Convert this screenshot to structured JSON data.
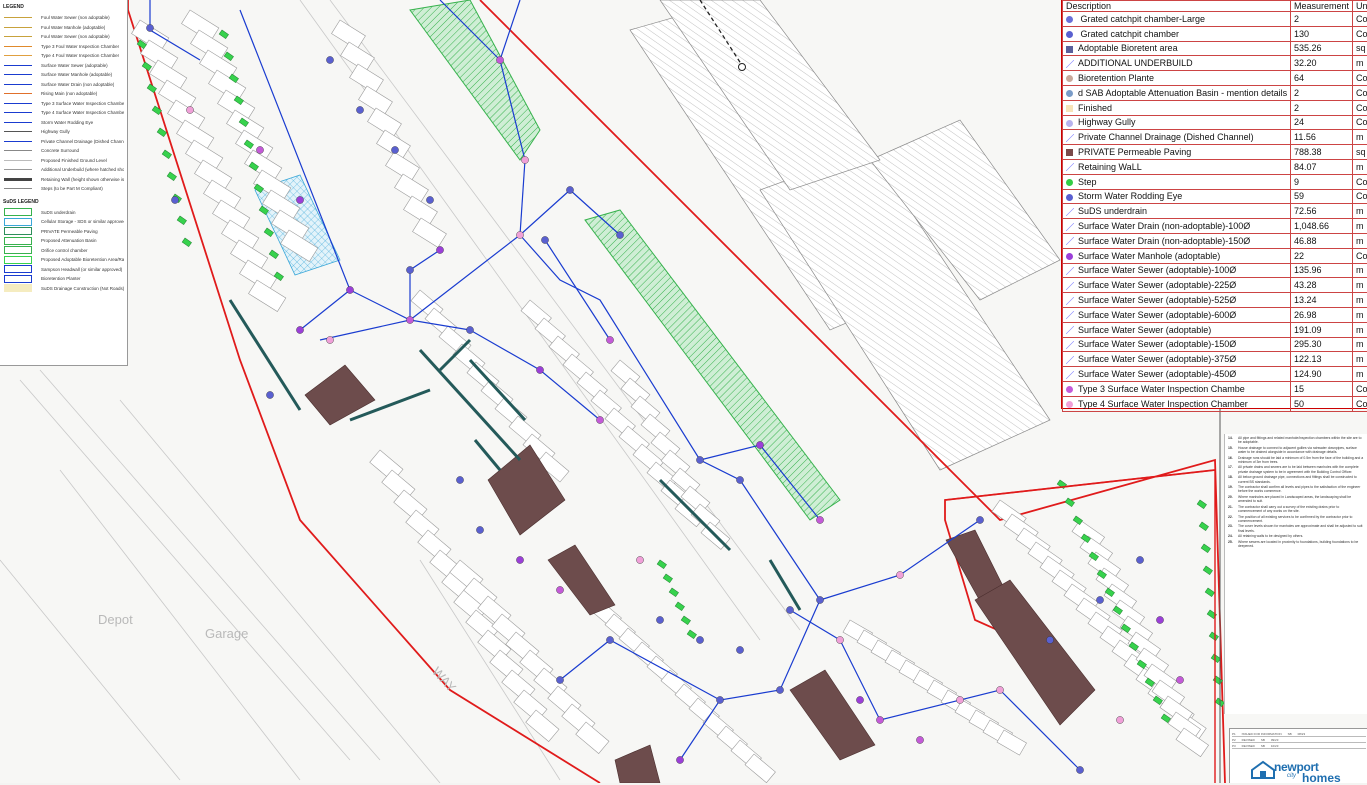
{
  "legend": {
    "title": "LEGEND",
    "items": [
      "Foul Water Sewer (non adoptable)",
      "Foul Water Manhole (adoptable)",
      "Foul Water Sewer (non adoptable)",
      "Type 3 Foul Water Inspection Chamber",
      "Type 4 Foul Water Inspection Chamber",
      "Surface Water Sewer (adoptable)",
      "Surface Water Manhole (adoptable)",
      "Surface Water Drain (non adoptable)",
      "Rising Main (non adoptable)",
      "Type 3 Surface Water Inspection Chamber",
      "Type 4 Surface Water Inspection Chamber",
      "Storm Water Rodding Eye",
      "Highway Gully",
      "Private Channel Drainage (Dished Channel)",
      "Concrete Surround",
      "Proposed Finished Ground Level",
      "Additional Underbuild (where hatched shown)",
      "Retaining Wall (height shown otherwise is levels - hatched line is retained side)",
      "Steps (to be Part M Compliant)"
    ],
    "suds_title": "SuDS LEGEND",
    "suds_items": [
      "SuDS underdrain",
      "Cellular Storage - SDS or similar approved",
      "PRIVATE Permeable Paving",
      "Proposed Attenuation Basin",
      "Orifice control chamber",
      "Proposed Adoptable Bioretention Area/Rain garden",
      "Sampson Headwall (or similar approved)",
      "Bioretention Planter",
      "SuDS Drainage Construction (Not Roads)"
    ]
  },
  "schedule": {
    "headers": [
      "Description",
      "Measurement",
      "Unit"
    ],
    "rows": [
      {
        "icon": "dot",
        "color": "#6a6fd8",
        "desc": " Grated catchpit chamber-Large",
        "value": "2",
        "unit": "Count"
      },
      {
        "icon": "dot",
        "color": "#5a60d0",
        "desc": " Grated catchpit chamber",
        "value": "130",
        "unit": "Count"
      },
      {
        "icon": "square",
        "color": "#5a5f9a",
        "desc": "Adoptable Bioretent area",
        "value": "535.26",
        "unit": "sq m"
      },
      {
        "icon": "slash",
        "color": "#8a8aff",
        "desc": "ADDITIONAL UNDERBUILD",
        "value": "32.20",
        "unit": "m"
      },
      {
        "icon": "dot",
        "color": "#c9a89a",
        "desc": "Bioretention Plante",
        "value": "64",
        "unit": "Count"
      },
      {
        "icon": "dot",
        "color": "#7a9cc8",
        "desc": "d SAB Adoptable Attenuation Basin - mention details",
        "value": "2",
        "unit": "Count"
      },
      {
        "icon": "square",
        "color": "#f7e3b8",
        "desc": "Finished",
        "value": "2",
        "unit": "Count"
      },
      {
        "icon": "dot",
        "color": "#b7b3ee",
        "desc": "Highway Gully",
        "value": "24",
        "unit": "Count"
      },
      {
        "icon": "slash",
        "color": "#8a8aff",
        "desc": "Private Channel Drainage (Dished Channel)",
        "value": "11.56",
        "unit": "m"
      },
      {
        "icon": "square",
        "color": "#7a4a4a",
        "desc": "PRIVATE Permeable Paving",
        "value": "788.38",
        "unit": "sq m"
      },
      {
        "icon": "slash",
        "color": "#8a8aff",
        "desc": "Retaining WaLL",
        "value": "84.07",
        "unit": "m"
      },
      {
        "icon": "dot",
        "color": "#33cc44",
        "desc": "Step",
        "value": "9",
        "unit": "Count"
      },
      {
        "icon": "dot",
        "color": "#5a5fd0",
        "desc": "Storm Water Rodding Eye",
        "value": "59",
        "unit": "Count"
      },
      {
        "icon": "slash",
        "color": "#8a8aff",
        "desc": "SuDS underdrain",
        "value": "72.56",
        "unit": "m"
      },
      {
        "icon": "slash",
        "color": "#8a8aff",
        "desc": "Surface Water Drain (non-adoptable)-100Ø",
        "value": "1,048.66",
        "unit": "m"
      },
      {
        "icon": "slash",
        "color": "#8a8aff",
        "desc": "Surface Water Drain (non-adoptable)-150Ø",
        "value": "46.88",
        "unit": "m"
      },
      {
        "icon": "dot",
        "color": "#9b3fd8",
        "desc": "Surface Water Manhole (adoptable)",
        "value": "22",
        "unit": "Count"
      },
      {
        "icon": "slash",
        "color": "#8a8aff",
        "desc": "Surface Water Sewer (adoptable)-100Ø",
        "value": "135.96",
        "unit": "m"
      },
      {
        "icon": "slash",
        "color": "#8a8aff",
        "desc": "Surface Water Sewer (adoptable)-225Ø",
        "value": "43.28",
        "unit": "m"
      },
      {
        "icon": "slash",
        "color": "#8a8aff",
        "desc": "Surface Water Sewer (adoptable)-525Ø",
        "value": "13.24",
        "unit": "m"
      },
      {
        "icon": "slash",
        "color": "#8a8aff",
        "desc": "Surface Water Sewer (adoptable)-600Ø",
        "value": "26.98",
        "unit": "m"
      },
      {
        "icon": "slash",
        "color": "#8a8aff",
        "desc": "Surface Water Sewer (adoptable)",
        "value": "191.09",
        "unit": "m"
      },
      {
        "icon": "slash",
        "color": "#8a8aff",
        "desc": "Surface Water Sewer (adoptable)-150Ø",
        "value": "295.30",
        "unit": "m"
      },
      {
        "icon": "slash",
        "color": "#8a8aff",
        "desc": "Surface Water Sewer (adoptable)-375Ø",
        "value": "122.13",
        "unit": "m"
      },
      {
        "icon": "slash",
        "color": "#8a8aff",
        "desc": "Surface Water Sewer (adoptable)-450Ø",
        "value": "124.90",
        "unit": "m"
      },
      {
        "icon": "dot",
        "color": "#c45ad8",
        "desc": "Type 3 Surface Water Inspection Chambe",
        "value": "15",
        "unit": "Count"
      },
      {
        "icon": "dot",
        "color": "#f0a0d8",
        "desc": "Type 4 Surface Water Inspection Chamber",
        "value": "50",
        "unit": "Count"
      }
    ]
  },
  "notes": [
    {
      "n": "14.",
      "t": "All pipe and fittings and related manhole/inspection chambers within the site are to be adoptable."
    },
    {
      "n": "15.",
      "t": "House drainage to connect to adjacent gullies via rainwater downpipes, surface water to be drained alongside in accordance with drainage details."
    },
    {
      "n": "16.",
      "t": "Drainage runs should be laid a minimum of 0.5m from the face of the building and a minimum of 3m from trees."
    },
    {
      "n": "17.",
      "t": "All private drains and sewers are to be laid between manholes with the complete private drainage system to be in agreement with the Building Control Officer."
    },
    {
      "n": "18.",
      "t": "All below ground drainage pipe, connections and fittings shall be constructed to current BS standards."
    },
    {
      "n": "19.",
      "t": "The contractor shall confirm all levels and pipes to the satisfaction of the engineer before the works commence."
    },
    {
      "n": "20.",
      "t": "Where manholes are placed in Landscaped areas, the landscaping shall be amended to suit."
    },
    {
      "n": "21.",
      "t": "The contractor shall carry out a survey of the existing drains prior to commencement of any works on the site."
    },
    {
      "n": "22.",
      "t": "The position of all existing services to be confirmed by the contractor prior to commencement."
    },
    {
      "n": "23.",
      "t": "The cover levels shown for manholes are approximate and shall be adjusted to suit final levels."
    },
    {
      "n": "24.",
      "t": "All retaining walls to be designed by others."
    },
    {
      "n": "25.",
      "t": "Where sewers are located in proximity to foundations, building foundations to be deepened."
    }
  ],
  "titleblock": {
    "rev_rows": [
      {
        "rev": "P1",
        "note": "ISSUED FOR INFORMATION",
        "by": "SB",
        "date": "08/23"
      },
      {
        "rev": "P2",
        "note": "REVISED",
        "by": "SB",
        "date": "09/23"
      },
      {
        "rev": "P3",
        "note": "REVISED",
        "by": "SB",
        "date": "10/23"
      }
    ],
    "logo_line1": "newport",
    "logo_line2": "homes",
    "logo_line3": "city"
  },
  "map_labels": {
    "depot": "Depot",
    "garage": "Garage",
    "road": "WAY"
  },
  "colors": {
    "boundary": "#e01b1b",
    "sewer": "#1a3cd0",
    "manhole": "#8a3fd6",
    "green_area": "#37b24d",
    "paving": "#6d4c4c",
    "building": "#6b6b6b"
  }
}
